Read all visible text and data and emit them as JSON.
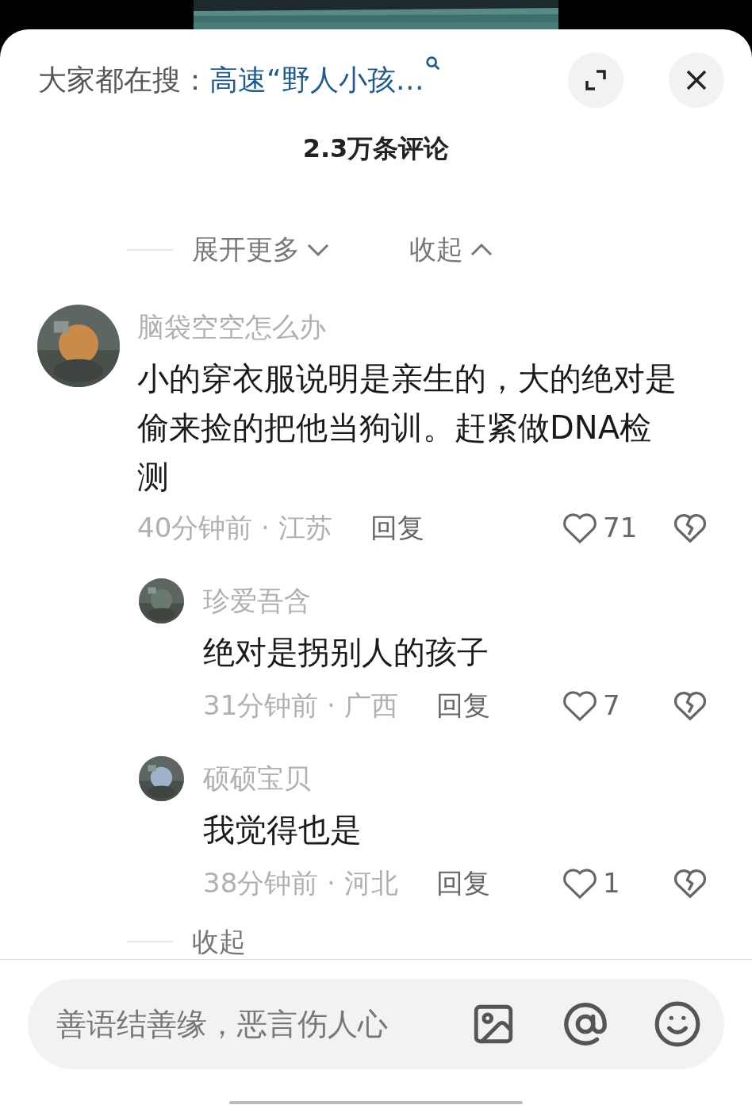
{
  "header": {
    "label": "大家都在搜：",
    "search_term": "高速“野人小孩…"
  },
  "comment_count": "2.3万条评论",
  "thread_controls": [
    {
      "label": "展开更多",
      "kind": "expand"
    },
    {
      "label": "收起",
      "kind": "collapse"
    }
  ],
  "comments": [
    {
      "user": "脑袋空空怎么办",
      "text": "小的穿衣服说明是亲生的，大的绝对是偷来捡的把他当狗训。赶紧做DNA检测",
      "time": "40分钟前",
      "separator": "·",
      "location": "江苏",
      "reply": "回复",
      "likes": "71",
      "replies": [
        {
          "user": "珍爱吾含",
          "text": "绝对是拐别人的孩子",
          "time": "31分钟前",
          "separator": "·",
          "location": "广西",
          "reply": "回复",
          "likes": "7"
        },
        {
          "user": "硕硕宝贝",
          "text": "我觉得也是",
          "time": "38分钟前",
          "separator": "·",
          "location": "河北",
          "reply": "回复",
          "likes": "1"
        }
      ]
    }
  ],
  "footer_control": {
    "label": "收起"
  },
  "input": {
    "placeholder": "善语结善缘，恶言伤人心"
  }
}
